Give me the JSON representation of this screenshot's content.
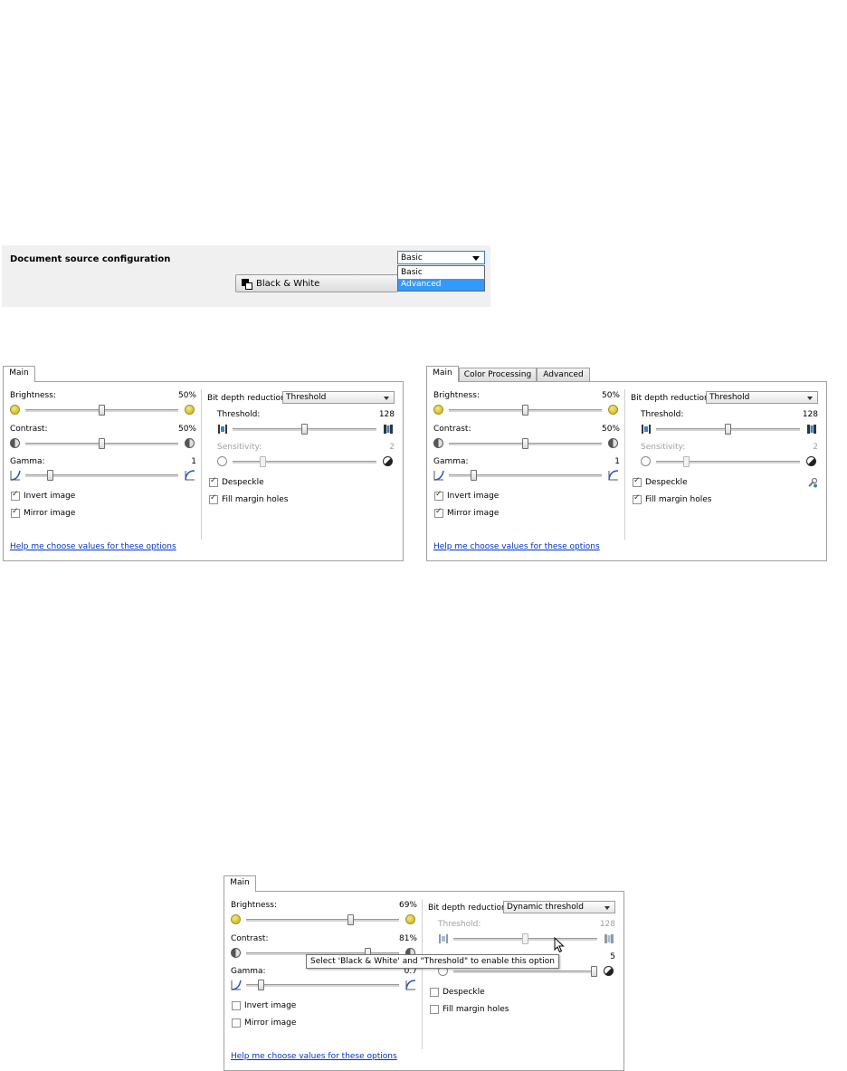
{
  "config": {
    "title": "Document source configuration",
    "dropdown_value": "Basic",
    "dropdown_options": [
      "Basic",
      "Advanced"
    ],
    "button_label": "Black & White"
  },
  "labels": {
    "brightness": "Brightness:",
    "contrast": "Contrast:",
    "gamma": "Gamma:",
    "invert": "Invert image",
    "mirror": "Mirror image",
    "bitdepth": "Bit depth reduction:",
    "threshold": "Threshold:",
    "sensitivity": "Sensitivity:",
    "despeckle": "Despeckle",
    "fillholes": "Fill margin holes",
    "help": "Help me choose values for these options"
  },
  "panel1": {
    "tabs": [
      "Main"
    ],
    "brightness": "50%",
    "brightness_level": 0.5,
    "contrast": "50%",
    "contrast_level": 0.5,
    "gamma": "1",
    "gamma_level": 0.15,
    "bitdepth": "Threshold",
    "threshold": "128",
    "threshold_level": 0.5,
    "sensitivity": "2",
    "sensitivity_level": 0.2,
    "invert": true,
    "mirror": true,
    "despeckle": true,
    "fillholes": true
  },
  "panel2": {
    "tabs": [
      "Main",
      "Color Processing",
      "Advanced"
    ],
    "brightness": "50%",
    "brightness_level": 0.5,
    "contrast": "50%",
    "contrast_level": 0.5,
    "gamma": "1",
    "gamma_level": 0.15,
    "bitdepth": "Threshold",
    "threshold": "128",
    "threshold_level": 0.5,
    "sensitivity": "2",
    "sensitivity_level": 0.2,
    "invert": true,
    "mirror": true,
    "despeckle": true,
    "fillholes": true
  },
  "panel3": {
    "tabs": [
      "Main"
    ],
    "brightness": "69%",
    "brightness_level": 0.69,
    "contrast": "81%",
    "contrast_level": 0.81,
    "gamma": "0.7",
    "gamma_level": 0.08,
    "bitdepth": "Dynamic threshold",
    "threshold": "128",
    "threshold_level": 0.5,
    "sensitivity": "5",
    "sensitivity_level": 1.0,
    "invert": false,
    "mirror": false,
    "despeckle": false,
    "fillholes": false,
    "tooltip": "Select 'Black & White' and \"Threshold\" to enable this option"
  }
}
